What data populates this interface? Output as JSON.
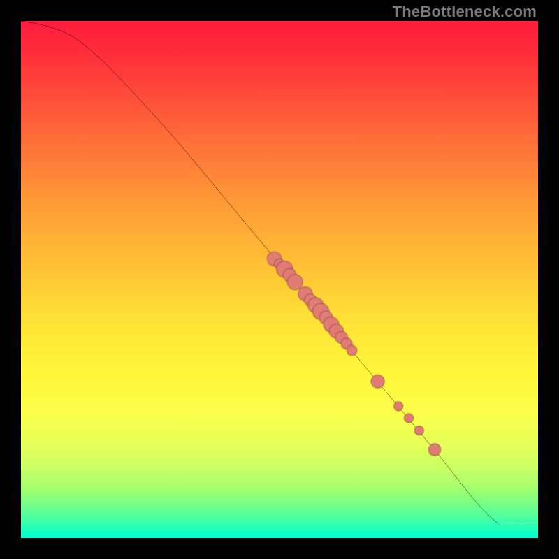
{
  "watermark": "TheBottleneck.com",
  "colors": {
    "point_fill": "#e37b75",
    "curve_stroke": "#000000",
    "background": "#000000"
  },
  "chart_data": {
    "type": "line",
    "title": "",
    "xlabel": "",
    "ylabel": "",
    "xlim": [
      0,
      100
    ],
    "ylim": [
      0,
      100
    ],
    "grid": false,
    "legend": false,
    "curve": [
      {
        "x": 0,
        "y": 100
      },
      {
        "x": 5,
        "y": 99
      },
      {
        "x": 10,
        "y": 97
      },
      {
        "x": 15,
        "y": 93
      },
      {
        "x": 20,
        "y": 88
      },
      {
        "x": 30,
        "y": 77
      },
      {
        "x": 40,
        "y": 65
      },
      {
        "x": 50,
        "y": 53
      },
      {
        "x": 60,
        "y": 41
      },
      {
        "x": 70,
        "y": 29
      },
      {
        "x": 80,
        "y": 17
      },
      {
        "x": 88,
        "y": 7
      },
      {
        "x": 92,
        "y": 3
      },
      {
        "x": 93,
        "y": 2.5
      },
      {
        "x": 100,
        "y": 2.5
      }
    ],
    "points": [
      {
        "x": 49,
        "y": 54,
        "r": 1.4
      },
      {
        "x": 50,
        "y": 53,
        "r": 1.0
      },
      {
        "x": 51,
        "y": 52,
        "r": 1.6
      },
      {
        "x": 52,
        "y": 50.8,
        "r": 1.3
      },
      {
        "x": 53,
        "y": 49.5,
        "r": 1.5
      },
      {
        "x": 55,
        "y": 47.2,
        "r": 1.4
      },
      {
        "x": 56,
        "y": 46,
        "r": 1.2
      },
      {
        "x": 57,
        "y": 45,
        "r": 1.5
      },
      {
        "x": 58,
        "y": 43.8,
        "r": 1.6
      },
      {
        "x": 59,
        "y": 42.6,
        "r": 1.3
      },
      {
        "x": 60,
        "y": 41.3,
        "r": 1.5
      },
      {
        "x": 61,
        "y": 40,
        "r": 1.4
      },
      {
        "x": 62,
        "y": 38.8,
        "r": 1.2
      },
      {
        "x": 63,
        "y": 37.6,
        "r": 1.1
      },
      {
        "x": 64,
        "y": 36.3,
        "r": 1.0
      },
      {
        "x": 69,
        "y": 30.3,
        "r": 1.3
      },
      {
        "x": 73,
        "y": 25.5,
        "r": 0.9
      },
      {
        "x": 75,
        "y": 23.2,
        "r": 0.9
      },
      {
        "x": 77,
        "y": 20.8,
        "r": 0.9
      },
      {
        "x": 80,
        "y": 17.1,
        "r": 1.2
      }
    ]
  }
}
